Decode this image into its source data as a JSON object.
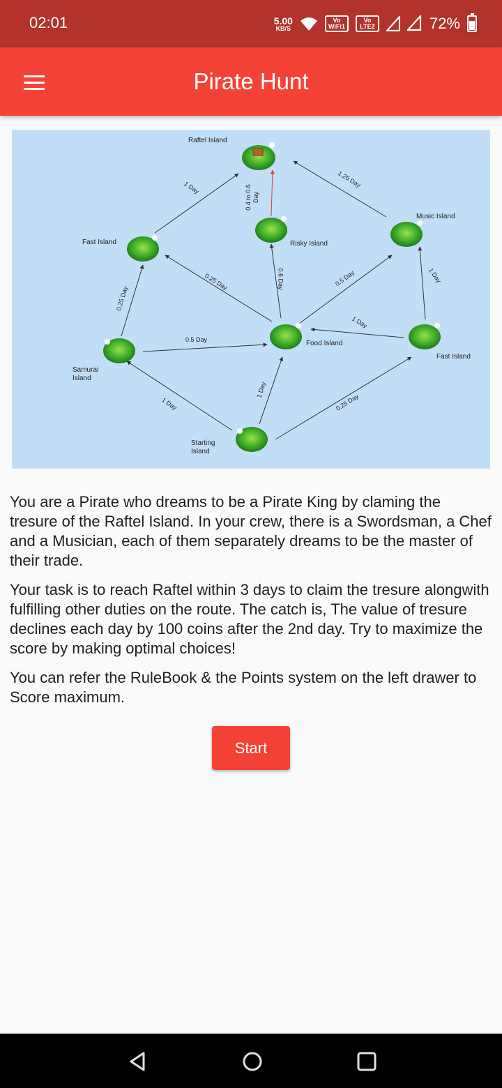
{
  "status_bar": {
    "time": "02:01",
    "speed_value": "5.00",
    "speed_unit": "KB/S",
    "wifi_chip": "Vo WiFi1",
    "lte_chip": "Vo LTE2",
    "battery": "72%"
  },
  "app_bar": {
    "title": "Pirate Hunt",
    "menu_icon": "menu-icon"
  },
  "map": {
    "islands": {
      "raftel": "Raftel Island",
      "music": "Music Island",
      "fast_left": "Fast Island",
      "risky": "Risky Island",
      "food": "Food Island",
      "fast_right": "Fast Island",
      "samurai_line1": "Samurai",
      "samurai_line2": "Island",
      "starting_line1": "Starting",
      "starting_line2": "Island"
    },
    "routes": {
      "fast_to_raftel": "1 Day",
      "music_to_raftel": "1.25 Day",
      "risky_to_raftel_line1": "0.4 to 0.6",
      "risky_to_raftel_line2": "Day",
      "food_to_fast_left": "0.25 Day",
      "food_to_risky": "0.6 Day",
      "food_to_music": "0.5 Day",
      "fast_right_to_music": "1 Day",
      "fast_right_to_food": "1 Day",
      "samurai_to_fast_left": "0.25 Day",
      "samurai_to_food": "0.5 Day",
      "start_to_samurai": "1 Day",
      "start_to_food": "1 Day",
      "start_to_fast_right": "0.25 Day"
    },
    "colors": {
      "sea": "#c2def7",
      "normal_route": "#333333",
      "risky_route": "#e53935"
    }
  },
  "description": {
    "p1": "You are a Pirate who dreams to be a Pirate King by claming the tresure of the Raftel Island. In your crew, there is a Swordsman, a Chef and a Musician, each of them separately dreams to be the master of their trade.",
    "p2": "Your task is to reach Raftel within 3 days to claim the tresure alongwith fulfilling other duties on the route. The catch is, The value of tresure declines each day by 100 coins after the 2nd day. Try to maximize the score by making optimal choices!",
    "p3": "You can refer the RuleBook & the Points system on the left drawer to Score maximum."
  },
  "start_button": "Start",
  "theme": {
    "primary": "#f44336",
    "status_bar": "#b3322b"
  }
}
